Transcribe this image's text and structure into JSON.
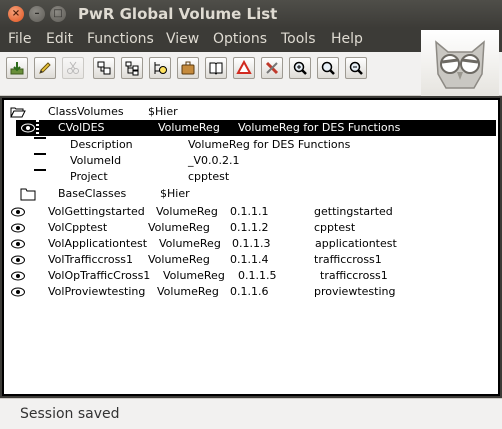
{
  "window": {
    "title": "PwR Global Volume List"
  },
  "menu": [
    "File",
    "Edit",
    "Functions",
    "View",
    "Options",
    "Tools",
    "Help"
  ],
  "toolbar_icons": [
    "save-icon",
    "edit-pencil-icon",
    "scissors-icon",
    "object-copy-icon",
    "tree-copy-icon",
    "navigator-icon",
    "briefcase-icon",
    "open-book-icon",
    "warning-triangle-icon",
    "tools-icon",
    "zoom-in-icon",
    "zoom-reset-icon",
    "zoom-out-icon"
  ],
  "tree": {
    "root": {
      "name": "ClassVolumes",
      "class": "$Hier"
    },
    "selected": {
      "name": "CVolDES",
      "class": "VolumeReg",
      "description": "VolumeReg for DES Functions"
    },
    "attributes": [
      {
        "name": "Description",
        "value": "VolumeReg for DES Functions"
      },
      {
        "name": "VolumeId",
        "value": "_V0.0.2.1"
      },
      {
        "name": "Project",
        "value": "cpptest"
      }
    ],
    "base": {
      "name": "BaseClasses",
      "class": "$Hier"
    },
    "volumes": [
      {
        "name": "VolGettingstarted",
        "class": "VolumeReg",
        "id": "0.1.1.1",
        "project": "gettingstarted"
      },
      {
        "name": "VolCpptest",
        "class": "VolumeReg",
        "id": "0.1.1.2",
        "project": "cpptest"
      },
      {
        "name": "VolApplicationtest",
        "class": "VolumeReg",
        "id": "0.1.1.3",
        "project": "applicationtest"
      },
      {
        "name": "VolTrafficcross1",
        "class": "VolumeReg",
        "id": "0.1.1.4",
        "project": "trafficcross1"
      },
      {
        "name": "VolOpTrafficCross1",
        "class": "VolumeReg",
        "id": "0.1.1.5",
        "project": "trafficcross1"
      },
      {
        "name": "VolProviewtesting",
        "class": "VolumeReg",
        "id": "0.1.1.6",
        "project": "proviewtesting"
      }
    ]
  },
  "status": "Session saved"
}
